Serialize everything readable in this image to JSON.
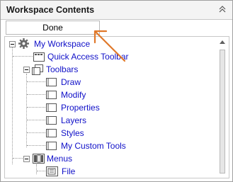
{
  "panel": {
    "title": "Workspace Contents",
    "done_label": "Done"
  },
  "tree": {
    "root": "My Workspace",
    "quick_access": "Quick Access Toolbar",
    "toolbars": "Toolbars",
    "toolbar_items": [
      "Draw",
      "Modify",
      "Properties",
      "Layers",
      "Styles",
      "My Custom Tools"
    ],
    "menus": "Menus",
    "menu_items": [
      "File"
    ]
  },
  "colors": {
    "link": "#1010c8",
    "annotation_arrow": "#e0782a"
  }
}
